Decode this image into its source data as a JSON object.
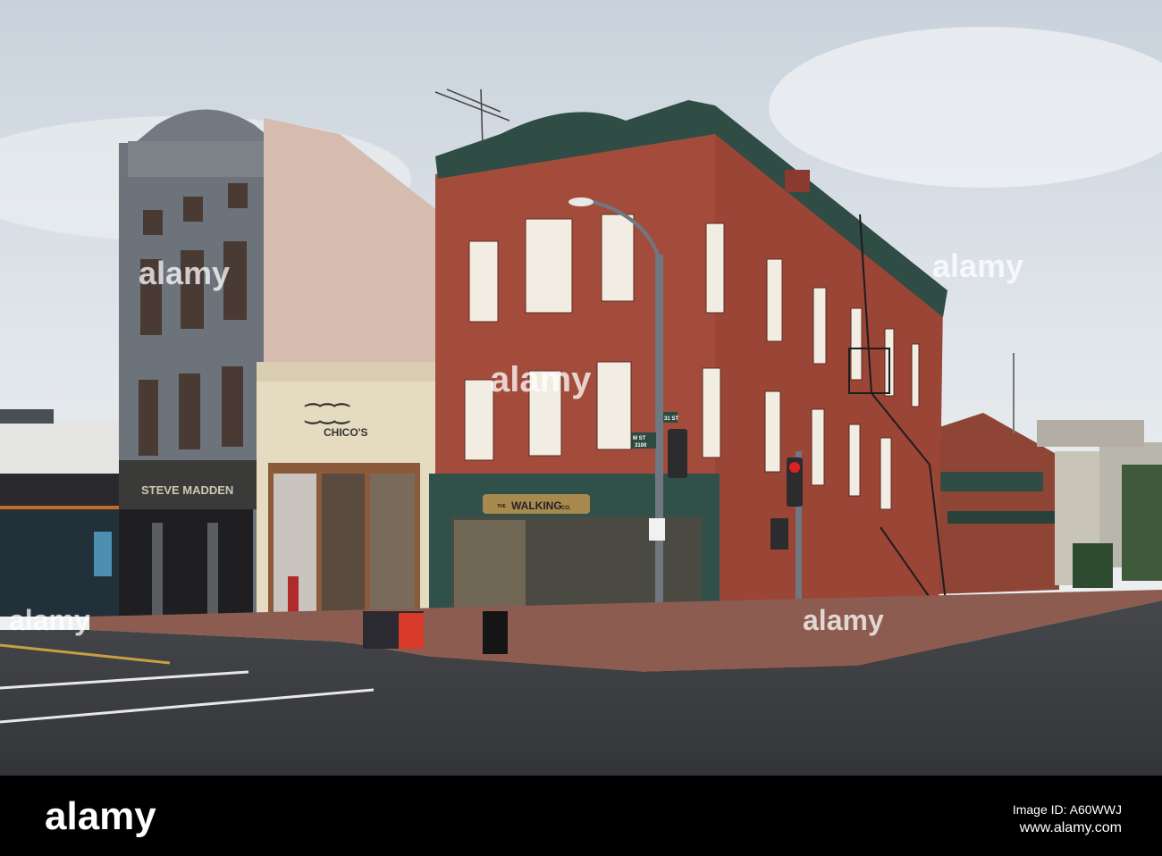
{
  "signs": {
    "steve_madden": "STEVE MADDEN",
    "chicos": "CHICO'S",
    "walking_co_prefix": "THE",
    "walking_co": "WALKING",
    "walking_co_suffix": "CO.",
    "street_31": "31 ST",
    "street_m": "M ST",
    "street_m_number": "3100"
  },
  "watermark": {
    "text": "alamy",
    "mark": "a"
  },
  "footer": {
    "logo": "alamy",
    "image_id": "Image ID: A60WWJ",
    "url": "www.alamy.com"
  },
  "colors": {
    "sky": "#d6dde4",
    "brick": "#a04a3a",
    "trim_green": "#2f4d44",
    "gray_building": "#6c737a",
    "road": "#3b3d41",
    "footer_bg": "#000000"
  }
}
